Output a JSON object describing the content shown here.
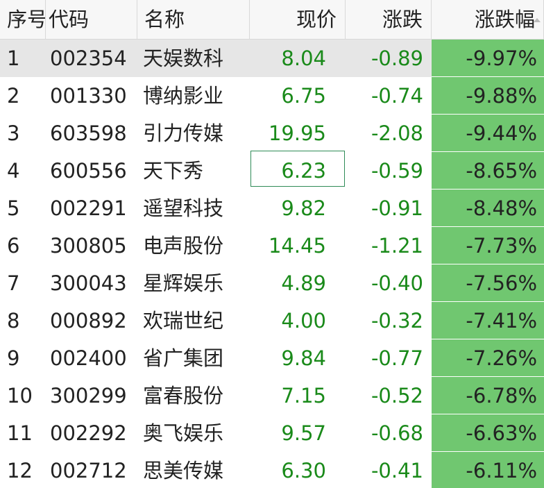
{
  "columns": {
    "seq": "序号",
    "code": "代码",
    "name": "名称",
    "price": "现价",
    "change": "涨跌",
    "pct": "涨跌幅"
  },
  "colors": {
    "down": "#1a8a1a",
    "pct_bg": "#70c770",
    "selected_row": "#e6e6e6"
  },
  "rows": [
    {
      "seq": "1",
      "code": "002354",
      "name": "天娱数科",
      "price": "8.04",
      "change": "-0.89",
      "pct": "-9.97%"
    },
    {
      "seq": "2",
      "code": "001330",
      "name": "博纳影业",
      "price": "6.75",
      "change": "-0.74",
      "pct": "-9.88%"
    },
    {
      "seq": "3",
      "code": "603598",
      "name": "引力传媒",
      "price": "19.95",
      "change": "-2.08",
      "pct": "-9.44%"
    },
    {
      "seq": "4",
      "code": "600556",
      "name": "天下秀",
      "price": "6.23",
      "change": "-0.59",
      "pct": "-8.65%"
    },
    {
      "seq": "5",
      "code": "002291",
      "name": "遥望科技",
      "price": "9.82",
      "change": "-0.91",
      "pct": "-8.48%"
    },
    {
      "seq": "6",
      "code": "300805",
      "name": "电声股份",
      "price": "14.45",
      "change": "-1.21",
      "pct": "-7.73%"
    },
    {
      "seq": "7",
      "code": "300043",
      "name": "星辉娱乐",
      "price": "4.89",
      "change": "-0.40",
      "pct": "-7.56%"
    },
    {
      "seq": "8",
      "code": "000892",
      "name": "欢瑞世纪",
      "price": "4.00",
      "change": "-0.32",
      "pct": "-7.41%"
    },
    {
      "seq": "9",
      "code": "002400",
      "name": "省广集团",
      "price": "9.84",
      "change": "-0.77",
      "pct": "-7.26%"
    },
    {
      "seq": "10",
      "code": "300299",
      "name": "富春股份",
      "price": "7.15",
      "change": "-0.52",
      "pct": "-6.78%"
    },
    {
      "seq": "11",
      "code": "002292",
      "name": "奥飞娱乐",
      "price": "9.57",
      "change": "-0.68",
      "pct": "-6.63%"
    },
    {
      "seq": "12",
      "code": "002712",
      "name": "思美传媒",
      "price": "6.30",
      "change": "-0.41",
      "pct": "-6.11%"
    }
  ]
}
